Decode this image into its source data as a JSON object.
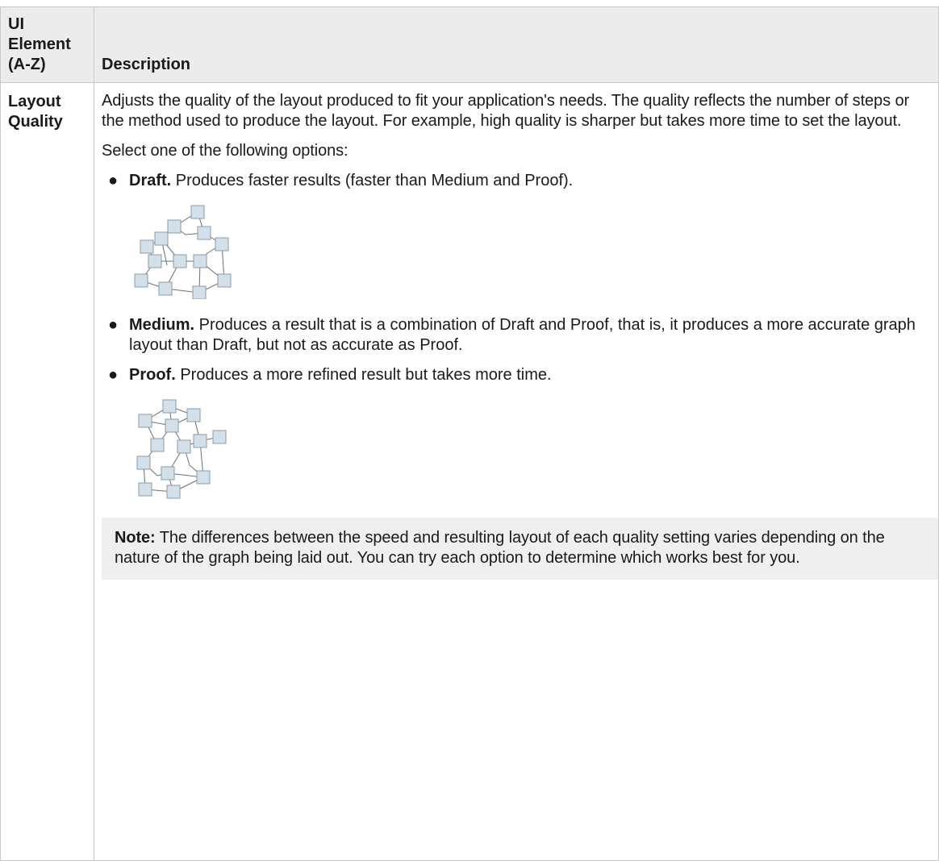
{
  "table": {
    "header": {
      "col1": "UI Element (A-Z)",
      "col1_lines": [
        "UI",
        "Element",
        "(A-Z)"
      ],
      "col2": "Description"
    },
    "row": {
      "name": "Layout Quality",
      "name_lines": [
        "Layout",
        "Quality"
      ],
      "intro": "Adjusts the quality of the layout produced to fit your application's needs. The quality reflects the number of steps or the method used to produce the layout. For example, high quality is sharper but takes more time to set the layout.",
      "select_text": "Select one of the following options:",
      "options": [
        {
          "title": "Draft.",
          "text": " Produces faster results (faster than Medium and Proof)."
        },
        {
          "title": "Medium.",
          "text": " Produces a result that is a combination of Draft and Proof, that is, it produces a more accurate graph layout than Draft, but not as accurate as Proof."
        },
        {
          "title": "Proof.",
          "text": " Produces a more refined result but takes more time."
        }
      ],
      "note": {
        "label": "Note:",
        "text": " The differences between the speed and resulting layout of each quality setting varies depending on the nature of the graph being laid out. You can try each option to determine which works best for you."
      }
    }
  },
  "colors": {
    "header_bg": "#ececec",
    "border": "#c9c9c9",
    "note_bg": "#efefef",
    "node_fill": "#d3e0e9",
    "node_stroke": "#8c9ba6",
    "edge": "#6f6f6f"
  }
}
